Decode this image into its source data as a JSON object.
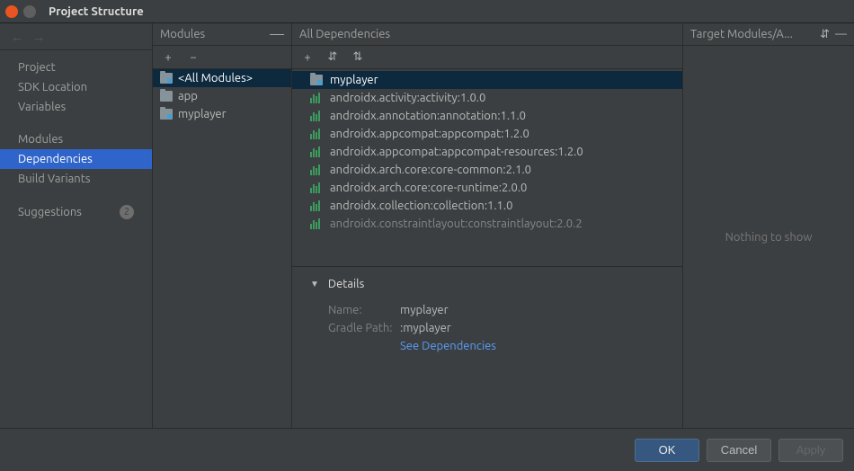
{
  "window": {
    "title": "Project Structure"
  },
  "nav": {
    "items": [
      "Project",
      "SDK Location",
      "Variables"
    ],
    "items2": [
      "Modules",
      "Dependencies",
      "Build Variants"
    ],
    "selected": "Dependencies",
    "suggestions_label": "Suggestions",
    "suggestions_count": "2"
  },
  "modules": {
    "header": "Modules",
    "items": [
      {
        "label": "<All Modules>",
        "type": "all",
        "selected": true
      },
      {
        "label": "app",
        "type": "module"
      },
      {
        "label": "myplayer",
        "type": "module"
      }
    ]
  },
  "deps": {
    "header": "All Dependencies",
    "items": [
      {
        "label": "myplayer",
        "type": "module",
        "selected": true
      },
      {
        "label": "androidx.activity:activity:1.0.0",
        "type": "lib"
      },
      {
        "label": "androidx.annotation:annotation:1.1.0",
        "type": "lib"
      },
      {
        "label": "androidx.appcompat:appcompat:1.2.0",
        "type": "lib"
      },
      {
        "label": "androidx.appcompat:appcompat-resources:1.2.0",
        "type": "lib"
      },
      {
        "label": "androidx.arch.core:core-common:2.1.0",
        "type": "lib"
      },
      {
        "label": "androidx.arch.core:core-runtime:2.0.0",
        "type": "lib"
      },
      {
        "label": "androidx.collection:collection:1.1.0",
        "type": "lib"
      },
      {
        "label": "androidx.constraintlayout:constraintlayout:2.0.2",
        "type": "lib",
        "faded": true
      }
    ]
  },
  "details": {
    "header": "Details",
    "name_label": "Name:",
    "name_value": "myplayer",
    "path_label": "Gradle Path:",
    "path_value": ":myplayer",
    "link": "See Dependencies"
  },
  "target": {
    "header": "Target Modules/A...",
    "empty": "Nothing to show"
  },
  "footer": {
    "ok": "OK",
    "cancel": "Cancel",
    "apply": "Apply"
  }
}
